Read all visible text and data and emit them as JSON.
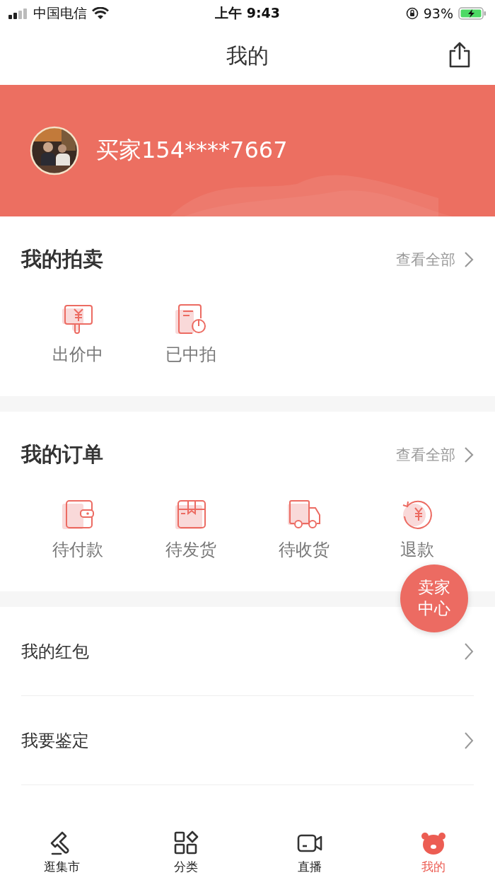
{
  "status_bar": {
    "carrier": "中国电信",
    "time": "上午 9:43",
    "battery": "93%"
  },
  "header": {
    "title": "我的"
  },
  "profile": {
    "name": "买家154****7667"
  },
  "sections": [
    {
      "title": "我的拍卖",
      "view_all": "查看全部",
      "items": [
        {
          "kind": "bid",
          "label": "出价中"
        },
        {
          "kind": "won",
          "label": "已中拍"
        }
      ]
    },
    {
      "title": "我的订单",
      "view_all": "查看全部",
      "items": [
        {
          "kind": "wallet",
          "label": "待付款"
        },
        {
          "kind": "box",
          "label": "待发货"
        },
        {
          "kind": "truck",
          "label": "待收货"
        },
        {
          "kind": "refund",
          "label": "退款"
        }
      ]
    }
  ],
  "menu": [
    {
      "label": "我的红包"
    },
    {
      "label": "我要鉴定"
    }
  ],
  "float_button": {
    "label": "卖家中心"
  },
  "tabs": [
    {
      "kind": "gavel",
      "label": "逛集市",
      "selected": false
    },
    {
      "kind": "grid",
      "label": "分类",
      "selected": false
    },
    {
      "kind": "video",
      "label": "直播",
      "selected": false
    },
    {
      "kind": "bear",
      "label": "我的",
      "selected": true
    }
  ]
}
